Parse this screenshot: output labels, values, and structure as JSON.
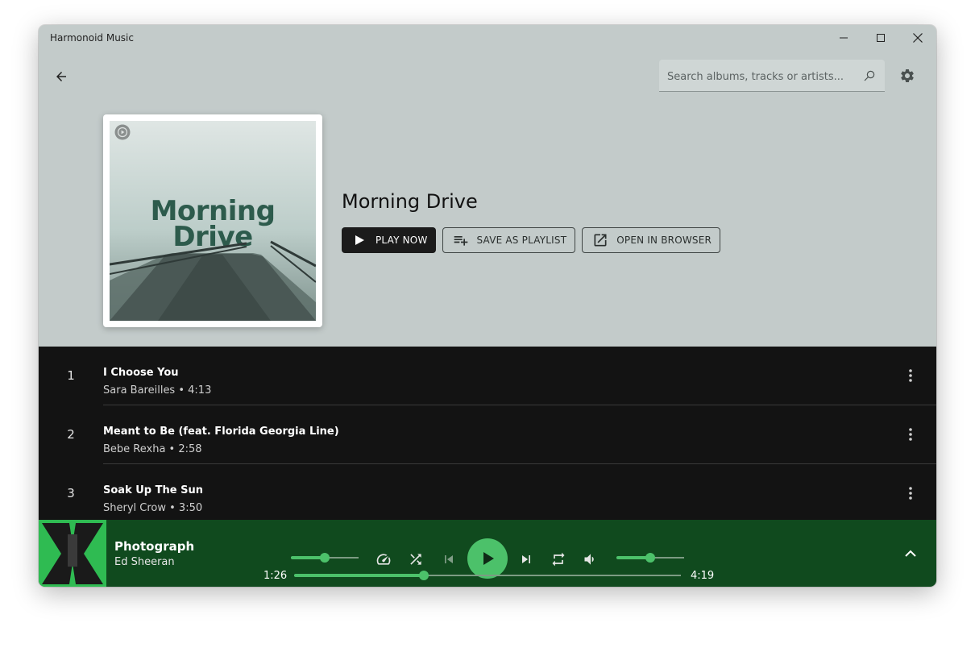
{
  "window": {
    "title": "Harmonoid Music"
  },
  "search": {
    "placeholder": "Search albums, tracks or artists..."
  },
  "playlist": {
    "title": "Morning Drive",
    "art_text_line1": "Morning",
    "art_text_line2": "Drive",
    "actions": {
      "play_now": "PLAY NOW",
      "save_as_playlist": "SAVE AS PLAYLIST",
      "open_in_browser": "OPEN IN BROWSER"
    }
  },
  "tracks": [
    {
      "number": "1",
      "title": "I Choose You",
      "subtitle": "Sara Bareilles • 4:13"
    },
    {
      "number": "2",
      "title": "Meant to Be (feat. Florida Georgia Line)",
      "subtitle": "Bebe Rexha • 2:58"
    },
    {
      "number": "3",
      "title": "Soak Up The Sun",
      "subtitle": "Sheryl Crow • 3:50"
    }
  ],
  "now_playing": {
    "title": "Photograph",
    "artist": "Ed Sheeran",
    "elapsed": "1:26",
    "duration": "4:19",
    "progress_fraction": 0.335,
    "speed_fraction": 0.5,
    "volume_fraction": 0.5
  },
  "colors": {
    "accent": "#4cc16a",
    "player_bg": "#104a1e",
    "header_bg": "#c3cbca",
    "list_bg": "#131313"
  },
  "icons": {
    "back": "arrow-back-icon",
    "search": "search-icon",
    "settings": "gear-icon",
    "minimize": "minimize-icon",
    "maximize": "maximize-icon",
    "close": "close-icon",
    "play": "play-icon",
    "playlist_add": "playlist-add-icon",
    "open_in_new": "open-in-new-icon",
    "more": "more-vert-icon",
    "speed": "speed-icon",
    "shuffle": "shuffle-icon",
    "previous": "skip-previous-icon",
    "next": "skip-next-icon",
    "repeat": "repeat-icon",
    "volume": "volume-icon",
    "expand": "chevron-up-icon"
  }
}
